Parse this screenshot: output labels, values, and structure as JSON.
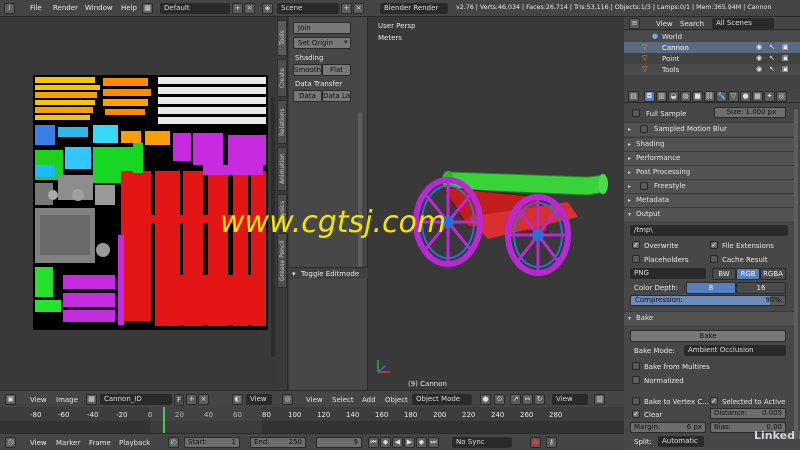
{
  "topbar": {
    "menus": [
      "File",
      "Render",
      "Window",
      "Help"
    ],
    "layout": "Default",
    "scene": "Scene",
    "engine": "Blender Render",
    "stats": "v2.76 | Verts:46,034 | Faces:26,714 | Tris:53,116 | Objects:1/3 | Lamps:0/1 | Mem:365.94M | Cannon"
  },
  "toolshelf": {
    "tabs": [
      "Tools",
      "Create",
      "Relations",
      "Animation",
      "Physics",
      "Grease Pencil"
    ],
    "join": "Join",
    "set_origin": "Set Origin",
    "shading_label": "Shading",
    "smooth": "Smooth",
    "flat": "Flat",
    "data_transfer_label": "Data Transfer",
    "data": "Data",
    "data_layout": "Data La",
    "toggle_editmode": "Toggle Editmode"
  },
  "viewport": {
    "view_name": "User Persp",
    "units": "Meters",
    "object_label": "(9) Cannon"
  },
  "watermark": {
    "text": "www.cgtsj.com",
    "color": "#f2e600",
    "corner": "Linked in"
  },
  "outliner": {
    "view": "View",
    "search": "Search",
    "scenes": "All Scenes",
    "items": [
      "World",
      "Cannon",
      "Point",
      "Tools"
    ]
  },
  "properties": {
    "full_sample": "Full Sample",
    "size_label": "Size:",
    "size_value": "1.000 px",
    "sampled_motion_blur": "Sampled Motion Blur",
    "shading": "Shading",
    "performance": "Performance",
    "post_processing": "Post Processing",
    "freestyle": "Freestyle",
    "metadata": "Metadata",
    "output": "Output",
    "path": "/tmp\\",
    "overwrite": "Overwrite",
    "file_extensions": "File Extensions",
    "placeholders": "Placeholders",
    "cache_result": "Cache Result",
    "format": "PNG",
    "bw": "BW",
    "rgb": "RGB",
    "rgba": "RGBA",
    "color_depth_label": "Color Depth:",
    "depth8": "8",
    "depth16": "16",
    "compression_label": "Compression:",
    "compression_value": "90%",
    "compression_fill": 0.9,
    "bake": "Bake",
    "bake_button": "Bake",
    "bake_mode_label": "Bake Mode:",
    "bake_mode": "Ambient Occlusion",
    "bake_from_multires": "Bake from Multires",
    "normalized": "Normalized",
    "bake_to_vertex": "Bake to Vertex C...",
    "selected_to_active": "Selected to Active",
    "clear": "Clear",
    "distance_label": "Distance:",
    "distance_value": "0.005",
    "margin_label": "Margin:",
    "margin_value": "6 px",
    "bias_label": "Bias:",
    "bias_value": "0.00",
    "split_label": "Split:",
    "split_value": "Automatic"
  },
  "image_editor_header": {
    "view": "View",
    "image": "Image",
    "image_name": "Cannon_ID",
    "f": "F",
    "view2": "View"
  },
  "viewport_header": {
    "view": "View",
    "select": "Select",
    "add": "Add",
    "object": "Object",
    "mode": "Object Mode",
    "view2": "View"
  },
  "timeline": {
    "ticks": [
      "-80",
      "-60",
      "-40",
      "-20",
      "0",
      "20",
      "40",
      "60",
      "80",
      "100",
      "120",
      "140",
      "160",
      "180",
      "200",
      "220",
      "240",
      "260",
      "280"
    ],
    "view": "View",
    "marker": "Marker",
    "frame": "Frame",
    "playback": "Playback",
    "start_label": "Start:",
    "start_value": "1",
    "end_label": "End:",
    "end_value": "250",
    "current": "9",
    "sync": "No Sync"
  }
}
